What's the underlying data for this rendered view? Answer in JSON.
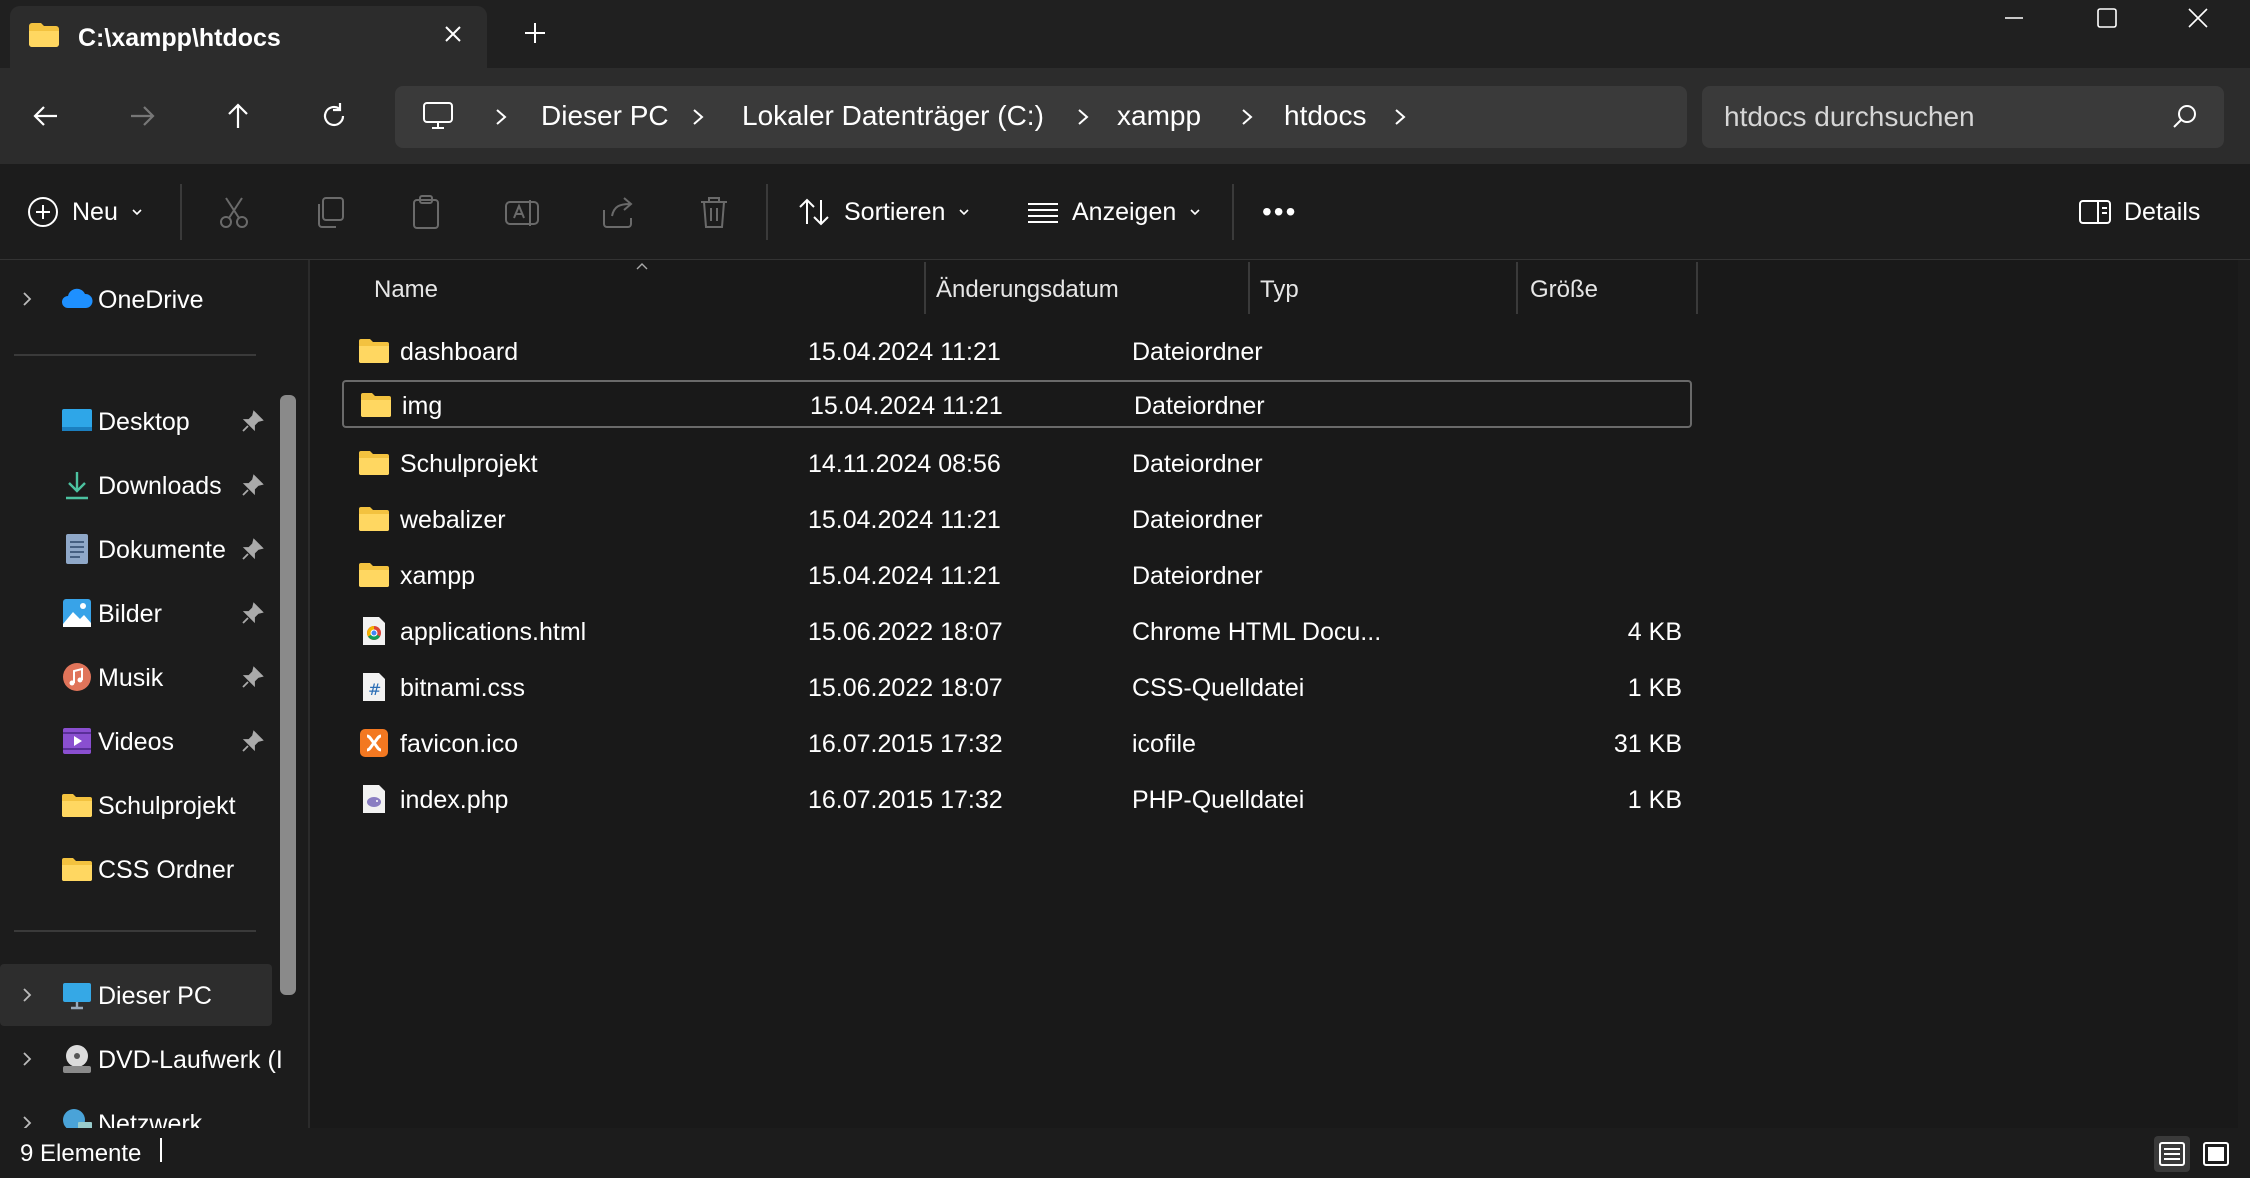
{
  "window": {
    "tab_title": "C:\\xampp\\htdocs",
    "controls": [
      "minimize",
      "maximize",
      "close"
    ]
  },
  "navigation": {
    "breadcrumbs": [
      "Dieser PC",
      "Lokaler Datenträger (C:)",
      "xampp",
      "htdocs"
    ],
    "search_placeholder": "htdocs durchsuchen"
  },
  "commandbar": {
    "new_label": "Neu",
    "sort_label": "Sortieren",
    "view_label": "Anzeigen",
    "more_label": "•••",
    "details_label": "Details"
  },
  "sidebar": {
    "onedrive": "OneDrive",
    "quick_access": [
      {
        "label": "Desktop",
        "icon": "desktop-icon",
        "pinned": true
      },
      {
        "label": "Downloads",
        "icon": "downloads-icon",
        "pinned": true
      },
      {
        "label": "Dokumente",
        "icon": "documents-icon",
        "pinned": true
      },
      {
        "label": "Bilder",
        "icon": "pictures-icon",
        "pinned": true
      },
      {
        "label": "Musik",
        "icon": "music-icon",
        "pinned": true
      },
      {
        "label": "Videos",
        "icon": "videos-icon",
        "pinned": true
      },
      {
        "label": "Schulprojekt",
        "icon": "folder-icon",
        "pinned": false
      },
      {
        "label": "CSS Ordner",
        "icon": "folder-icon",
        "pinned": false
      }
    ],
    "this_pc": "Dieser PC",
    "dvd": "DVD-Laufwerk (I",
    "network": "Netzwerk"
  },
  "filelist": {
    "columns": {
      "name": "Name",
      "date": "Änderungsdatum",
      "type": "Typ",
      "size": "Größe"
    },
    "rows": [
      {
        "name": "dashboard",
        "date": "15.04.2024 11:21",
        "type": "Dateiordner",
        "size": "",
        "icon": "folder-icon"
      },
      {
        "name": "img",
        "date": "15.04.2024 11:21",
        "type": "Dateiordner",
        "size": "",
        "icon": "folder-icon",
        "selected": true
      },
      {
        "name": "Schulprojekt",
        "date": "14.11.2024 08:56",
        "type": "Dateiordner",
        "size": "",
        "icon": "folder-icon"
      },
      {
        "name": "webalizer",
        "date": "15.04.2024 11:21",
        "type": "Dateiordner",
        "size": "",
        "icon": "folder-icon"
      },
      {
        "name": "xampp",
        "date": "15.04.2024 11:21",
        "type": "Dateiordner",
        "size": "",
        "icon": "folder-icon"
      },
      {
        "name": "applications.html",
        "date": "15.06.2022 18:07",
        "type": "Chrome HTML Docu...",
        "size": "4 KB",
        "icon": "chrome-html-icon"
      },
      {
        "name": "bitnami.css",
        "date": "15.06.2022 18:07",
        "type": "CSS-Quelldatei",
        "size": "1 KB",
        "icon": "css-file-icon"
      },
      {
        "name": "favicon.ico",
        "date": "16.07.2015 17:32",
        "type": "icofile",
        "size": "31 KB",
        "icon": "xampp-ico-icon"
      },
      {
        "name": "index.php",
        "date": "16.07.2015 17:32",
        "type": "PHP-Quelldatei",
        "size": "1 KB",
        "icon": "php-file-icon"
      }
    ]
  },
  "status": {
    "item_count": "9 Elemente"
  },
  "colors": {
    "folder": "#f3c23f",
    "background": "#191919",
    "chrome": "#202020",
    "panel": "#2c2c2c"
  }
}
